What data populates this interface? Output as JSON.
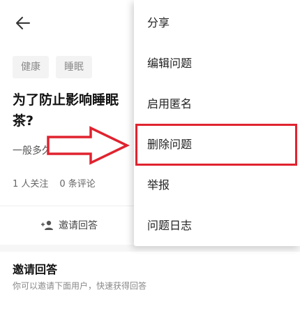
{
  "header": {
    "back_icon": "back-arrow-icon"
  },
  "question": {
    "tags": [
      "健康",
      "睡眠"
    ],
    "title": "为了防止影响睡眠茶?",
    "title_line1": "为了防止影响睡眠",
    "title_line2": "茶?",
    "description": "一般多久茶叶的提神效",
    "followers": "1 人关注",
    "comments": "0 条评论"
  },
  "invite_button": {
    "label": "邀请回答",
    "icon": "add-user-icon"
  },
  "invite_section": {
    "title": "邀请回答",
    "subtitle": "你可以邀请下面用户，快速获得回答"
  },
  "menu": {
    "items": [
      "分享",
      "编辑问题",
      "启用匿名",
      "删除问题",
      "举报",
      "问题日志"
    ],
    "highlighted_index": 3
  },
  "annotation": {
    "arrow_color": "#e0232f",
    "box_color": "#e0232f"
  }
}
